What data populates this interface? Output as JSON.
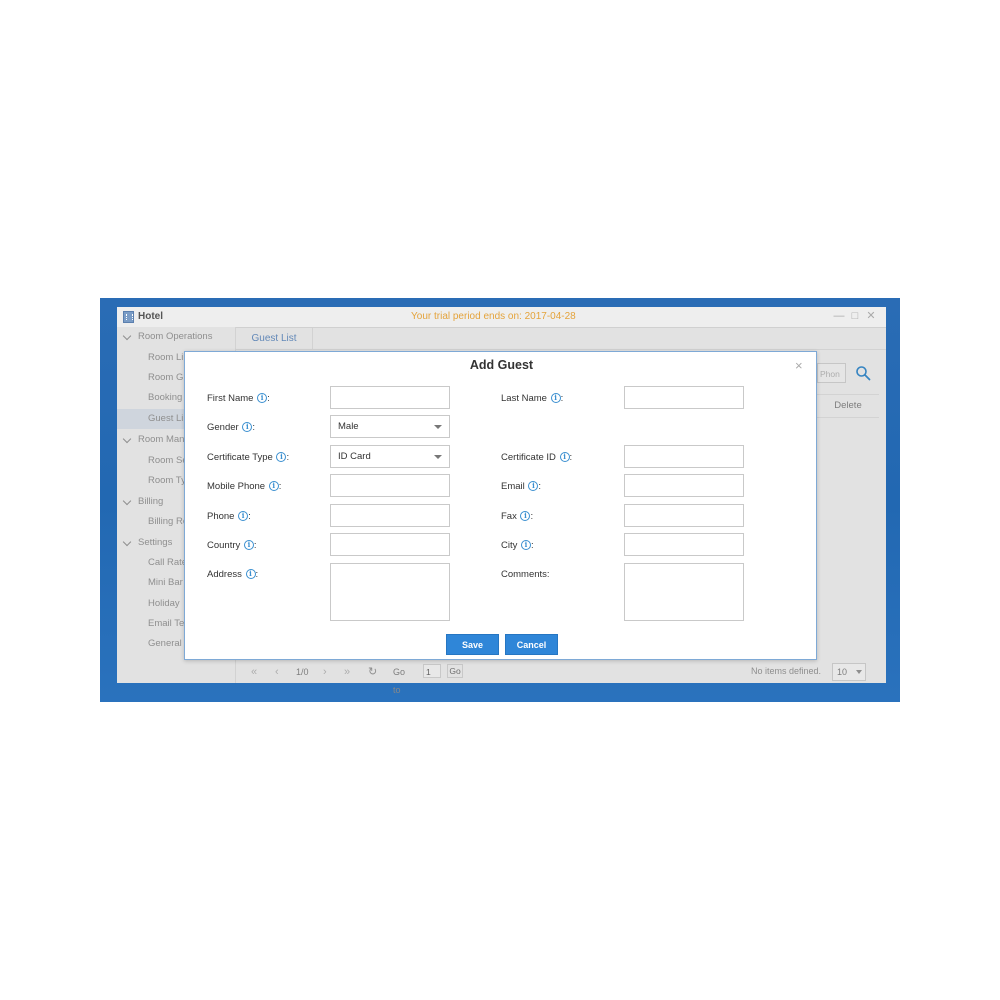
{
  "window": {
    "title": "Hotel",
    "trial_notice": "Your trial period ends on: 2017-04-28",
    "controls": {
      "minimize": "—",
      "maximize": "□",
      "close": "✕"
    }
  },
  "sidebar": {
    "groups": [
      {
        "label": "Room Operations",
        "items": [
          "Room Li",
          "Room G",
          "Booking",
          "Guest Li"
        ]
      },
      {
        "label": "Room Man",
        "items": [
          "Room Se",
          "Room Ty"
        ]
      },
      {
        "label": "Billing",
        "items": [
          "Billing Re"
        ]
      },
      {
        "label": "Settings",
        "items": [
          "Call Rate",
          "Mini Bar",
          "Holiday",
          "Email Te",
          "General"
        ]
      }
    ],
    "active_item": "Guest Li"
  },
  "main": {
    "tab": "Guest List",
    "search_placeholder": "Phon",
    "column_delete": "Delete",
    "pager": {
      "first": "«",
      "prev": "‹",
      "page_info": "1/0",
      "next": "›",
      "last": "»",
      "refresh": "↻",
      "goto_label": "Go to",
      "goto_value": "1",
      "go_label": "Go",
      "no_items": "No items defined.",
      "page_size": "10"
    }
  },
  "dialog": {
    "title": "Add Guest",
    "close": "×",
    "info_glyph": "i",
    "colon": ":",
    "fields": {
      "first_name": "First Name",
      "last_name": "Last Name",
      "gender": "Gender",
      "gender_value": "Male",
      "certificate_type": "Certificate Type",
      "certificate_type_value": "ID Card",
      "certificate_id": "Certificate ID",
      "mobile_phone": "Mobile Phone",
      "email": "Email",
      "phone": "Phone",
      "fax": "Fax",
      "country": "Country",
      "city": "City",
      "address": "Address",
      "comments": "Comments:"
    },
    "save_label": "Save",
    "cancel_label": "Cancel"
  },
  "colors": {
    "accent": "#2f86d8",
    "desktop": "#2268b2",
    "trial": "#e4a33b"
  }
}
